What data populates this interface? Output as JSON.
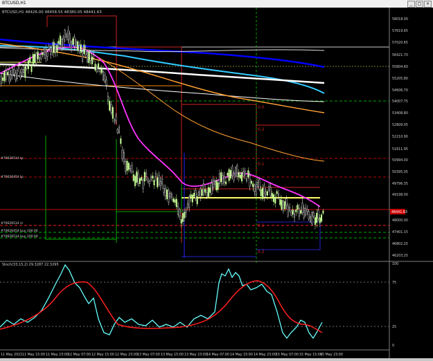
{
  "window": {
    "title": "BTCUSD,H1",
    "buttons": [
      "_",
      "□",
      "×"
    ]
  },
  "main_header": "BTCUSD,H1  48426.00 48458.55 48380.05 48441.63",
  "price_axis": [
    "58018.00",
    "57619.65",
    "57020.65",
    "56421.70",
    "55804.60",
    "55205.80",
    "54606.70",
    "54007.75",
    "53408.80",
    "52809.05",
    "52210.90",
    "51611.95",
    "50994.00",
    "50395.05",
    "49796.35",
    "49198.00",
    "48441.63",
    "48000.00",
    "47401.15",
    "46802.25",
    "46203.25"
  ],
  "current_price": "48441.63",
  "order_labels": [
    {
      "text": "#70626514 tp",
      "color": "#dddddd"
    },
    {
      "text": "#70626454 tp",
      "color": "#dddddd"
    },
    {
      "text": "#70626514 sl",
      "color": "#dddddd"
    },
    {
      "text": "#70626454 buy 100.00",
      "color": "#dddddd"
    },
    {
      "text": "#70626514 buy 100.00",
      "color": "#dddddd"
    }
  ],
  "level_labels": [
    "0.0",
    "0.2",
    "0.1",
    "0.1",
    "0.2"
  ],
  "stoch": {
    "header": "Stoch(33,15,2) 29.3287 22.3295",
    "axis": [
      "100",
      "75",
      "25",
      "0"
    ]
  },
  "time_axis": [
    "11 May 2021",
    "11 May 15:00",
    "11 May 23:00",
    "12 May 07:00",
    "12 May 15:00",
    "12 May 23:00",
    "13 May 07:00",
    "13 May 15:00",
    "13 May 23:00",
    "14 May 07:00",
    "14 May 15:00",
    "14 May 23:00",
    "15 May 07:00",
    "15 May 15:00",
    "15 May 23:00"
  ],
  "colors": {
    "bull_candle": "#c8ff96",
    "bear_candle": "#ffffff",
    "ma_magenta": "#ff33ff",
    "ma_orange": "#ffa033",
    "ma_blue": "#0000ff",
    "ma_cyan": "#33ccff",
    "stoch_main": "#66ffff",
    "stoch_signal": "#ff2020",
    "level_yellow": "#ffff66",
    "level_red": "#c00000",
    "level_green": "#00aa00"
  }
}
